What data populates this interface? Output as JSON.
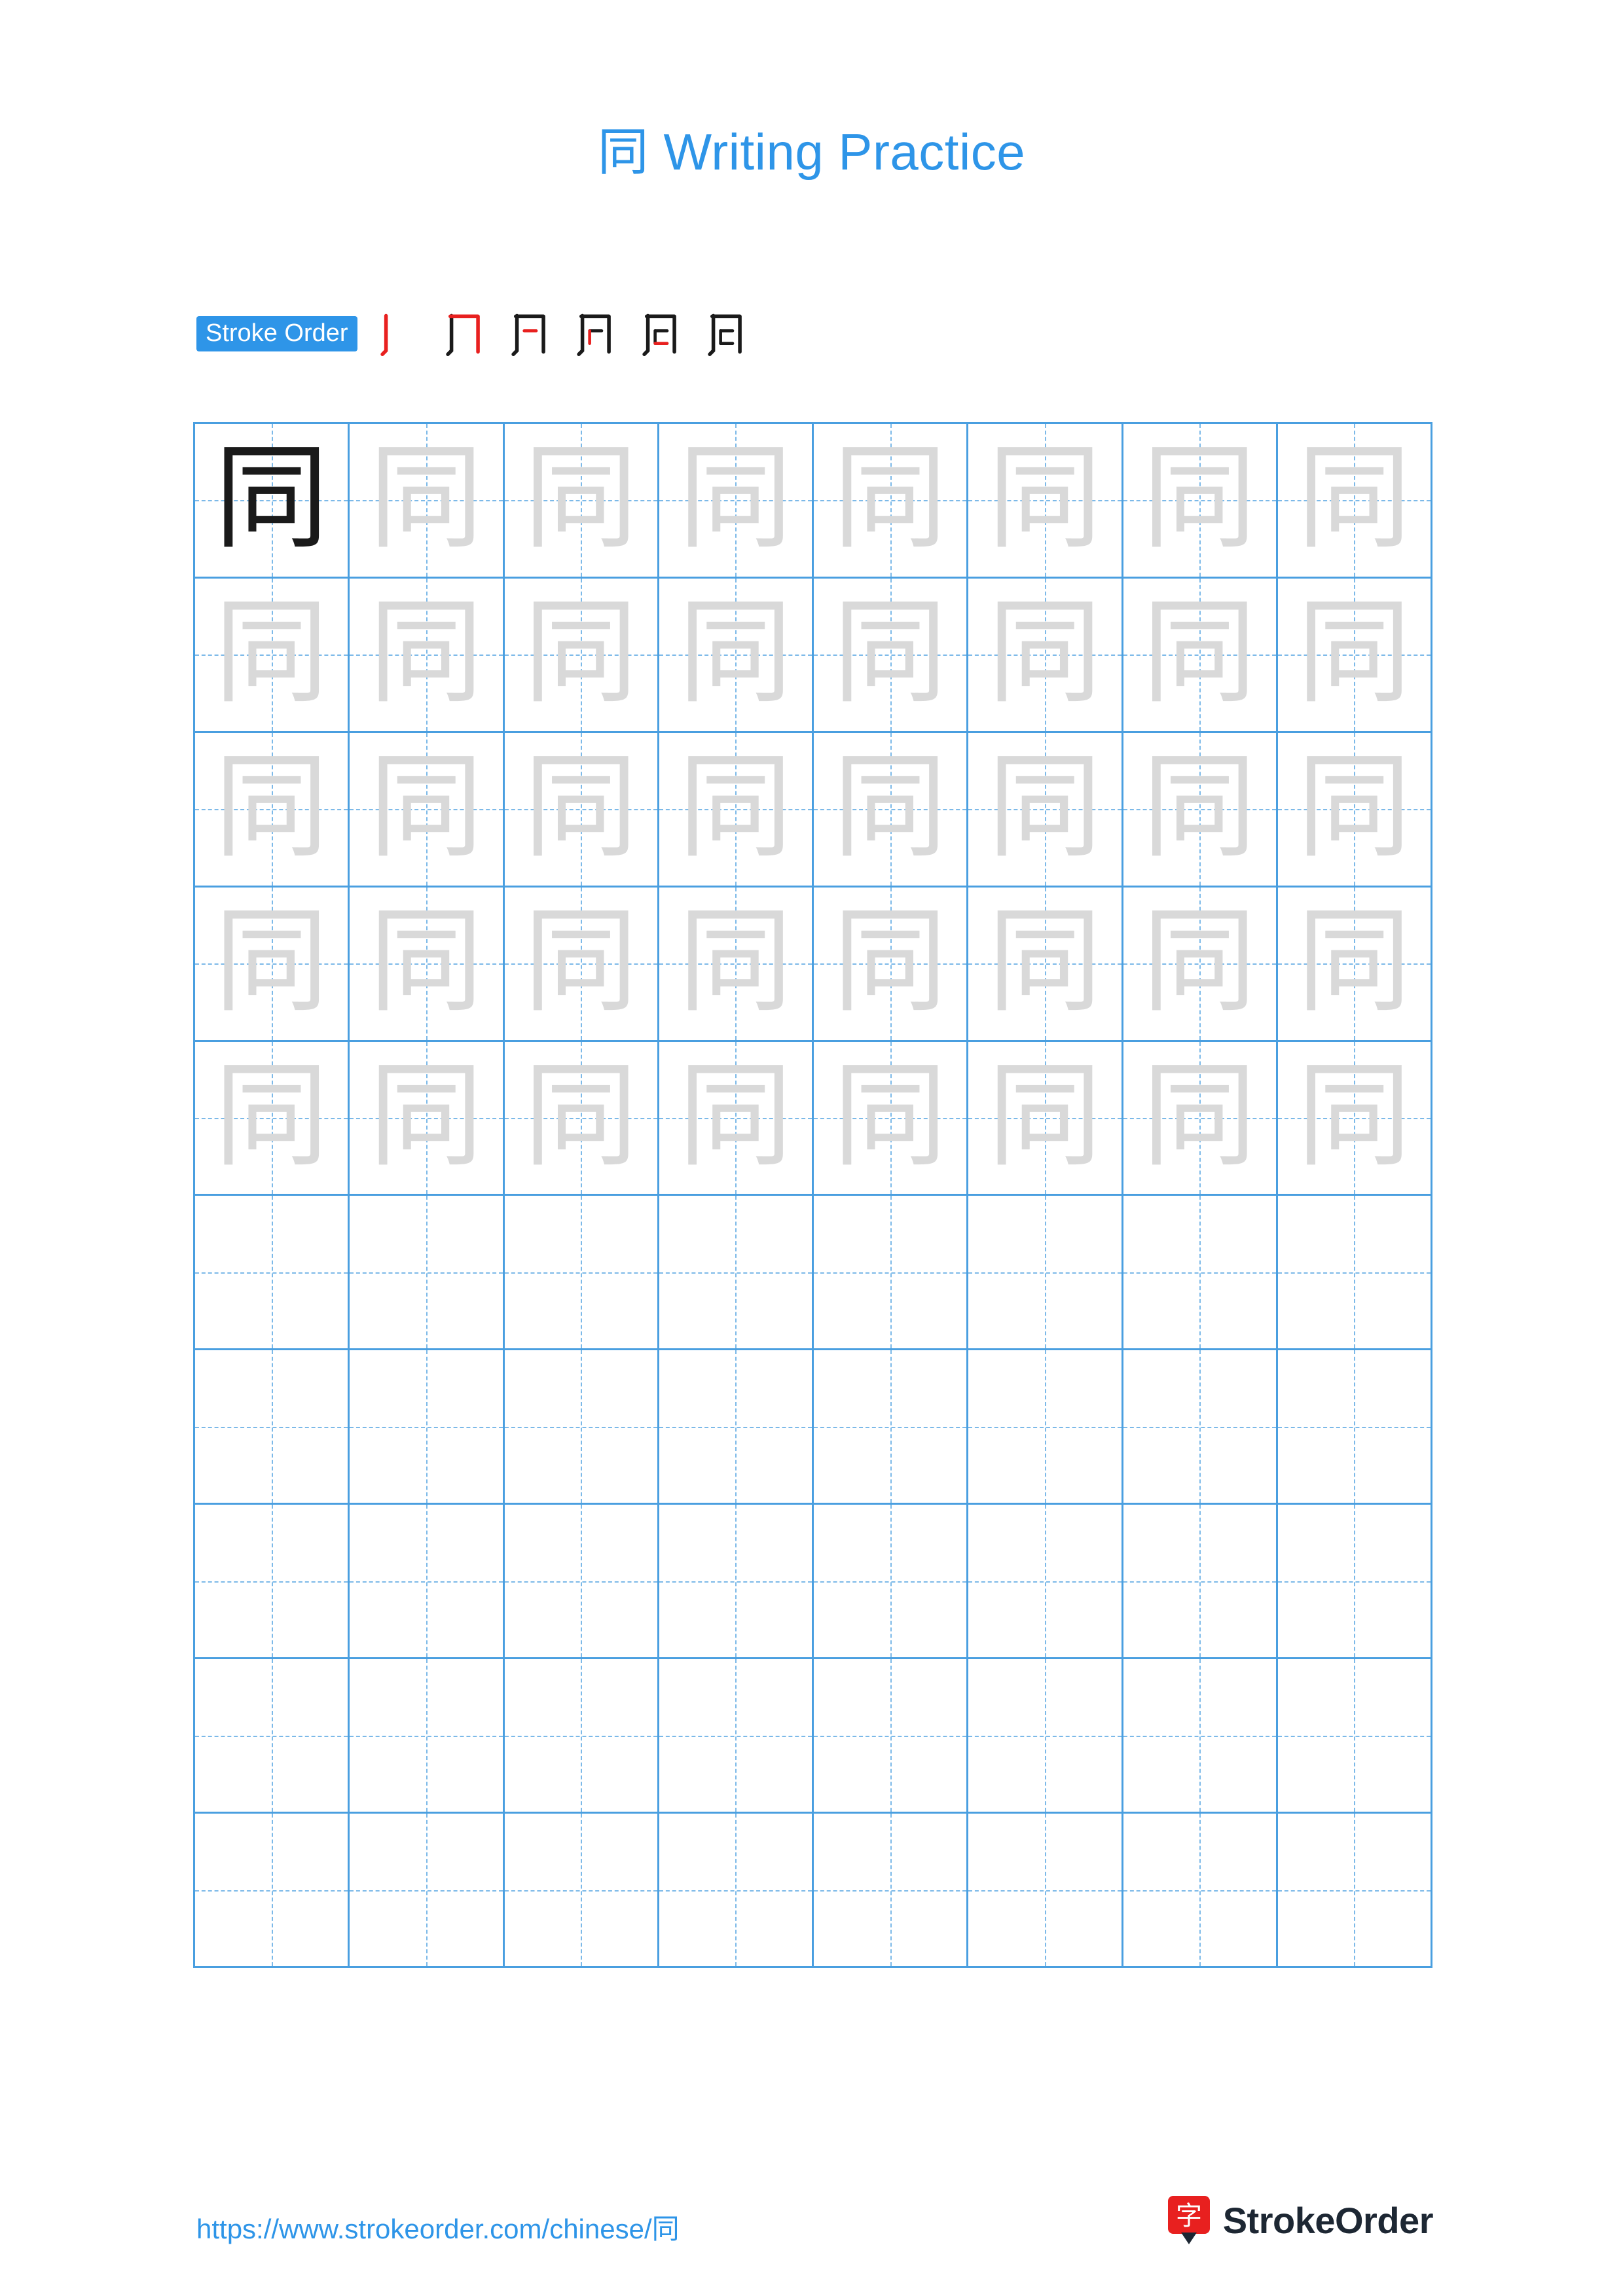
{
  "document": {
    "title_character": "同",
    "title_suffix": " Writing Practice",
    "title_color": "#2e95e8"
  },
  "stroke_order": {
    "label": "Stroke Order",
    "badge_color": "#2e95e8",
    "highlight_color": "#e8201f",
    "ink_color": "#1a1a1a",
    "steps": [
      {
        "index": 1,
        "partial": "丨"
      },
      {
        "index": 2,
        "partial": "冂"
      },
      {
        "index": 3,
        "partial": "冃"
      },
      {
        "index": 4,
        "partial": "冋"
      },
      {
        "index": 5,
        "partial": "同"
      },
      {
        "index": 6,
        "partial": "同"
      }
    ]
  },
  "grid": {
    "columns": 8,
    "rows": 10,
    "line_color": "#4a9fe0",
    "guide_color": "#7cb9e8",
    "character": "同",
    "solid_color": "#1a1a1a",
    "trace_color": "#d9d9d9",
    "cells": [
      [
        "solid",
        "trace",
        "trace",
        "trace",
        "trace",
        "trace",
        "trace",
        "trace"
      ],
      [
        "trace",
        "trace",
        "trace",
        "trace",
        "trace",
        "trace",
        "trace",
        "trace"
      ],
      [
        "trace",
        "trace",
        "trace",
        "trace",
        "trace",
        "trace",
        "trace",
        "trace"
      ],
      [
        "trace",
        "trace",
        "trace",
        "trace",
        "trace",
        "trace",
        "trace",
        "trace"
      ],
      [
        "trace",
        "trace",
        "trace",
        "trace",
        "trace",
        "trace",
        "trace",
        "trace"
      ],
      [
        "empty",
        "empty",
        "empty",
        "empty",
        "empty",
        "empty",
        "empty",
        "empty"
      ],
      [
        "empty",
        "empty",
        "empty",
        "empty",
        "empty",
        "empty",
        "empty",
        "empty"
      ],
      [
        "empty",
        "empty",
        "empty",
        "empty",
        "empty",
        "empty",
        "empty",
        "empty"
      ],
      [
        "empty",
        "empty",
        "empty",
        "empty",
        "empty",
        "empty",
        "empty",
        "empty"
      ],
      [
        "empty",
        "empty",
        "empty",
        "empty",
        "empty",
        "empty",
        "empty",
        "empty"
      ]
    ]
  },
  "footer": {
    "url": "https://www.strokeorder.com/chinese/同",
    "url_color": "#2e95e8",
    "brand_name": "StrokeOrder",
    "brand_logo_character": "字",
    "brand_logo_color": "#e8201f"
  }
}
